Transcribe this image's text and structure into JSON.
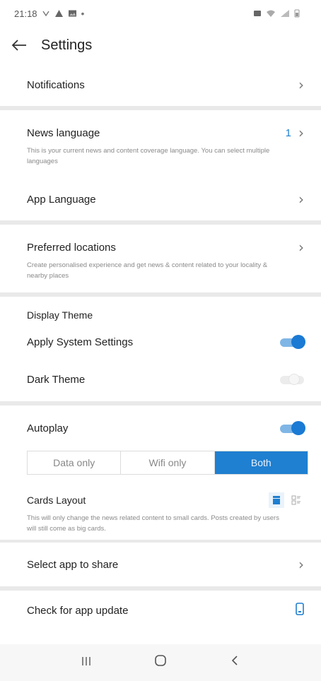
{
  "status_bar": {
    "time": "21:18",
    "left_icons": [
      "notification-icon",
      "warning-icon",
      "image-icon",
      "dot-icon"
    ],
    "right_icons": [
      "alarm-icon",
      "wifi-icon",
      "signal-icon",
      "battery-icon"
    ]
  },
  "header": {
    "title": "Settings"
  },
  "rows": {
    "notifications": {
      "label": "Notifications"
    },
    "news_language": {
      "label": "News language",
      "count": "1",
      "description": "This is your current news and content coverage language. You can select multiple languages"
    },
    "app_language": {
      "label": "App Language"
    },
    "preferred_locations": {
      "label": "Preferred locations",
      "description": "Create personalised experience and get news & content related to your locality & nearby places"
    },
    "display_theme": {
      "heading": "Display Theme"
    },
    "apply_system_settings": {
      "label": "Apply System Settings",
      "enabled": true
    },
    "dark_theme": {
      "label": "Dark Theme",
      "enabled": false
    },
    "autoplay": {
      "label": "Autoplay",
      "enabled": true,
      "options": [
        "Data only",
        "Wifi only",
        "Both"
      ],
      "selected": "Both"
    },
    "cards_layout": {
      "label": "Cards Layout",
      "description": "This will only change the news related content to small cards. Posts created by users will still come as big cards.",
      "selected": "big-cards"
    },
    "select_app_to_share": {
      "label": "Select app to share"
    },
    "check_for_app_update": {
      "label": "Check for app update"
    }
  },
  "colors": {
    "accent": "#1f7fd0",
    "toggle_track_on": "#7fb6e6",
    "separator": "#e9e9e9"
  },
  "nav_bar": {
    "buttons": [
      "recent-apps",
      "home",
      "back"
    ]
  }
}
